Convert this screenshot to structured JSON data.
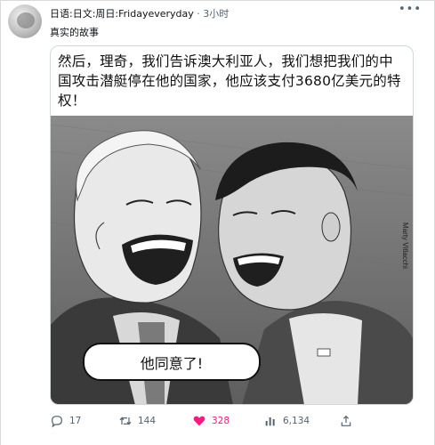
{
  "header": {
    "author": "日语:日文:周日:Fridayeveryday",
    "separator": "·",
    "time": "3小时",
    "more_icon": "more-horizontal-icon"
  },
  "tweet": {
    "text": "真实的故事"
  },
  "media": {
    "caption": "然后，理奇，我们告诉澳大利亚人，我们想把我们的中国攻击潜艇停在他的国家，他应该支付3680亿美元的特权！",
    "bubble_text": "他同意了!",
    "signature": "Marty Vitlacchi"
  },
  "actions": {
    "reply_count": "17",
    "retweet_count": "144",
    "like_count": "328",
    "views_count": "6,134",
    "like_color": "#f91880"
  }
}
